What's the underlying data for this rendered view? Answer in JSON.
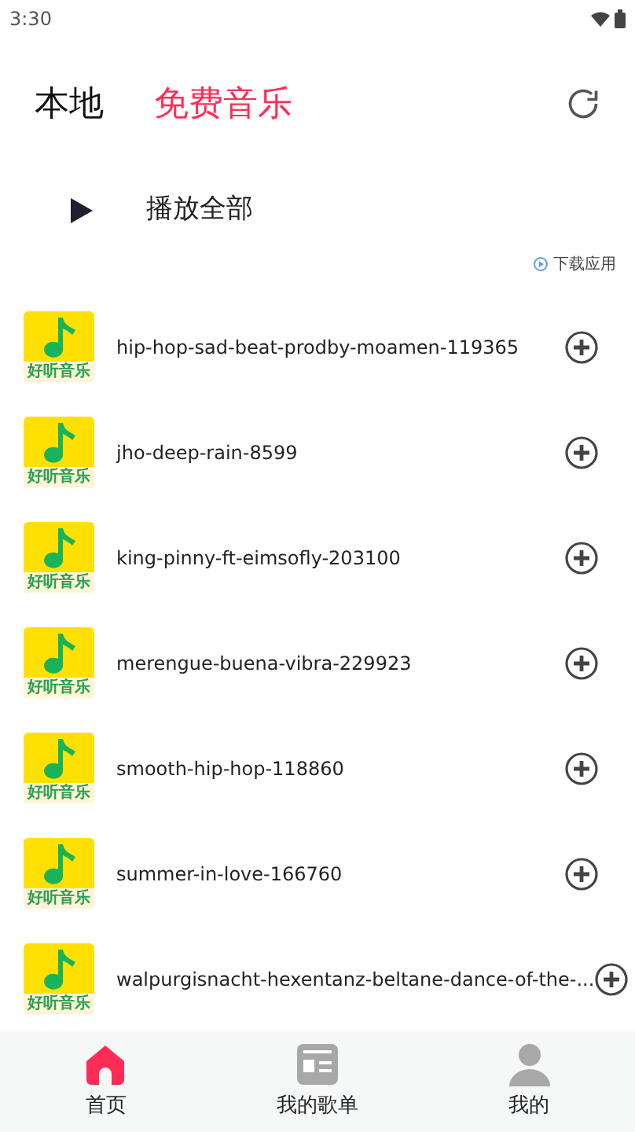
{
  "status_bar": {
    "time": "3:30"
  },
  "tabs": [
    {
      "label": "本地",
      "selected": false
    },
    {
      "label": "免费音乐",
      "selected": true
    }
  ],
  "play_all": {
    "label": "播放全部"
  },
  "ad": {
    "action": "下载应用"
  },
  "songs": [
    {
      "cover_label": "好听音乐",
      "title": "hip-hop-sad-beat-prodby-moamen-119365"
    },
    {
      "cover_label": "好听音乐",
      "title": "jho-deep-rain-8599"
    },
    {
      "cover_label": "好听音乐",
      "title": "king-pinny-ft-eimsofly-203100"
    },
    {
      "cover_label": "好听音乐",
      "title": "merengue-buena-vibra-229923"
    },
    {
      "cover_label": "好听音乐",
      "title": "smooth-hip-hop-118860"
    },
    {
      "cover_label": "好听音乐",
      "title": "summer-in-love-166760"
    },
    {
      "cover_label": "好听音乐",
      "title": "walpurgisnacht-hexentanz-beltane-dance-of-the-..."
    }
  ],
  "nav": [
    {
      "kind": "home",
      "label": "首页",
      "selected": true
    },
    {
      "kind": "playlist",
      "label": "我的歌单",
      "selected": false
    },
    {
      "kind": "profile",
      "label": "我的",
      "selected": false
    }
  ]
}
